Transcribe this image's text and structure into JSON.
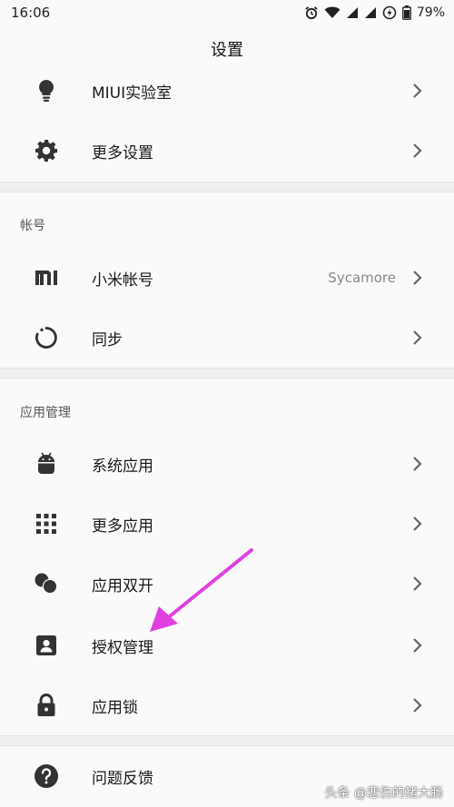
{
  "status_bar": {
    "time": "16:06",
    "battery": "79%",
    "icons": [
      "alarm-icon",
      "wifi-icon",
      "signal-icon",
      "signal-icon",
      "charging-icon",
      "battery-icon"
    ]
  },
  "title": "设置",
  "rows_top": [
    {
      "label": "MIUI实验室",
      "icon": "lightbulb-icon"
    },
    {
      "label": "更多设置",
      "icon": "gear-icon"
    }
  ],
  "account_section": {
    "header": "帐号",
    "items": [
      {
        "label": "小米帐号",
        "value": "Sycamore",
        "icon": "mi-logo-icon"
      },
      {
        "label": "同步",
        "icon": "sync-icon"
      }
    ]
  },
  "apps_section": {
    "header": "应用管理",
    "items": [
      {
        "label": "系统应用",
        "icon": "android-icon"
      },
      {
        "label": "更多应用",
        "icon": "grid-icon"
      },
      {
        "label": "应用双开",
        "icon": "dual-app-icon"
      },
      {
        "label": "授权管理",
        "icon": "permission-icon"
      },
      {
        "label": "应用锁",
        "icon": "lock-icon"
      }
    ]
  },
  "rows_bottom": [
    {
      "label": "问题反馈",
      "icon": "help-icon"
    }
  ],
  "watermark": "头条 @悲伤的猪大肠",
  "colors": {
    "annotation_arrow": "#e040e0",
    "icon": "#333333",
    "divider": "#efefef"
  }
}
